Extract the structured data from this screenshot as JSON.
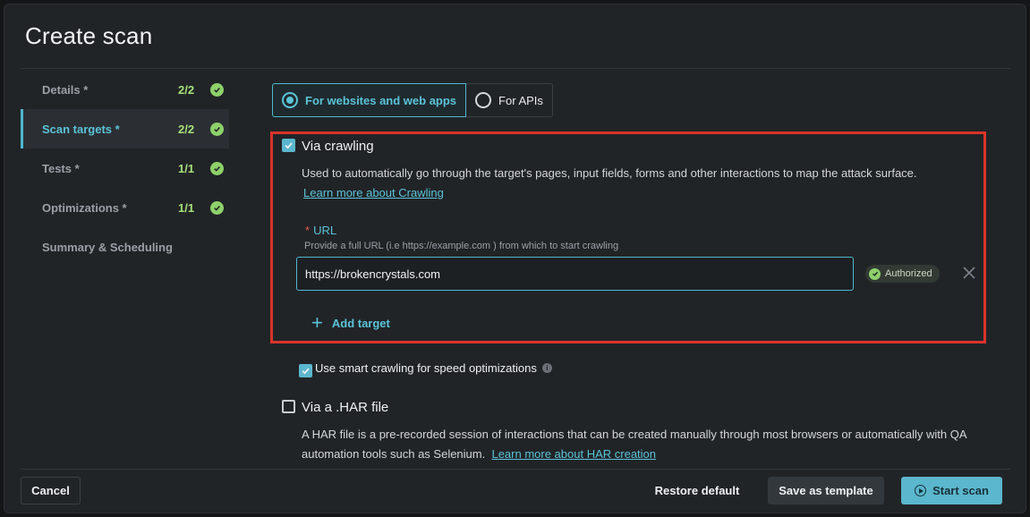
{
  "dialog": {
    "title": "Create scan"
  },
  "steps": [
    {
      "label": "Details *",
      "count": "2/2",
      "complete": true,
      "active": false
    },
    {
      "label": "Scan targets *",
      "count": "2/2",
      "complete": true,
      "active": true
    },
    {
      "label": "Tests *",
      "count": "1/1",
      "complete": true,
      "active": false
    },
    {
      "label": "Optimizations *",
      "count": "1/1",
      "complete": true,
      "active": false
    },
    {
      "label": "Summary & Scheduling",
      "count": "",
      "complete": false,
      "active": false
    }
  ],
  "target_type": {
    "options": [
      "For websites and web apps",
      "For APIs"
    ],
    "selected": "For websites and web apps"
  },
  "crawling": {
    "checked": true,
    "title": "Via crawling",
    "description": "Used to automatically go through the target's pages, input fields, forms and other interactions to map the attack surface.",
    "learn_more": "Learn more about Crawling",
    "url_label_required": "*",
    "url_label": "URL",
    "url_hint": "Provide a full URL (i.e https://example.com ) from which to start crawling",
    "url_value": "https://brokencrystals.com",
    "badge": "Authorized",
    "add_target": "Add target"
  },
  "smart_crawling": {
    "checked": true,
    "label": "Use smart crawling for speed optimizations"
  },
  "har": {
    "checked": false,
    "title": "Via a .HAR file",
    "description_line1": "A HAR file is a pre-recorded session of interactions that can be created manually through most browsers or automatically with QA",
    "description_line2": "automation tools such as Selenium.",
    "learn_more": "Learn more about HAR creation"
  },
  "footer": {
    "cancel": "Cancel",
    "restore": "Restore default",
    "save_template": "Save as template",
    "start": "Start scan"
  },
  "colors": {
    "accent": "#5bc3d8",
    "success": "#8ed16b",
    "highlight_border": "#d9342b"
  },
  "icons": {
    "check": "check-icon",
    "close": "close-icon",
    "plus": "plus-icon",
    "info": "info-icon",
    "play": "play-circle-icon"
  }
}
